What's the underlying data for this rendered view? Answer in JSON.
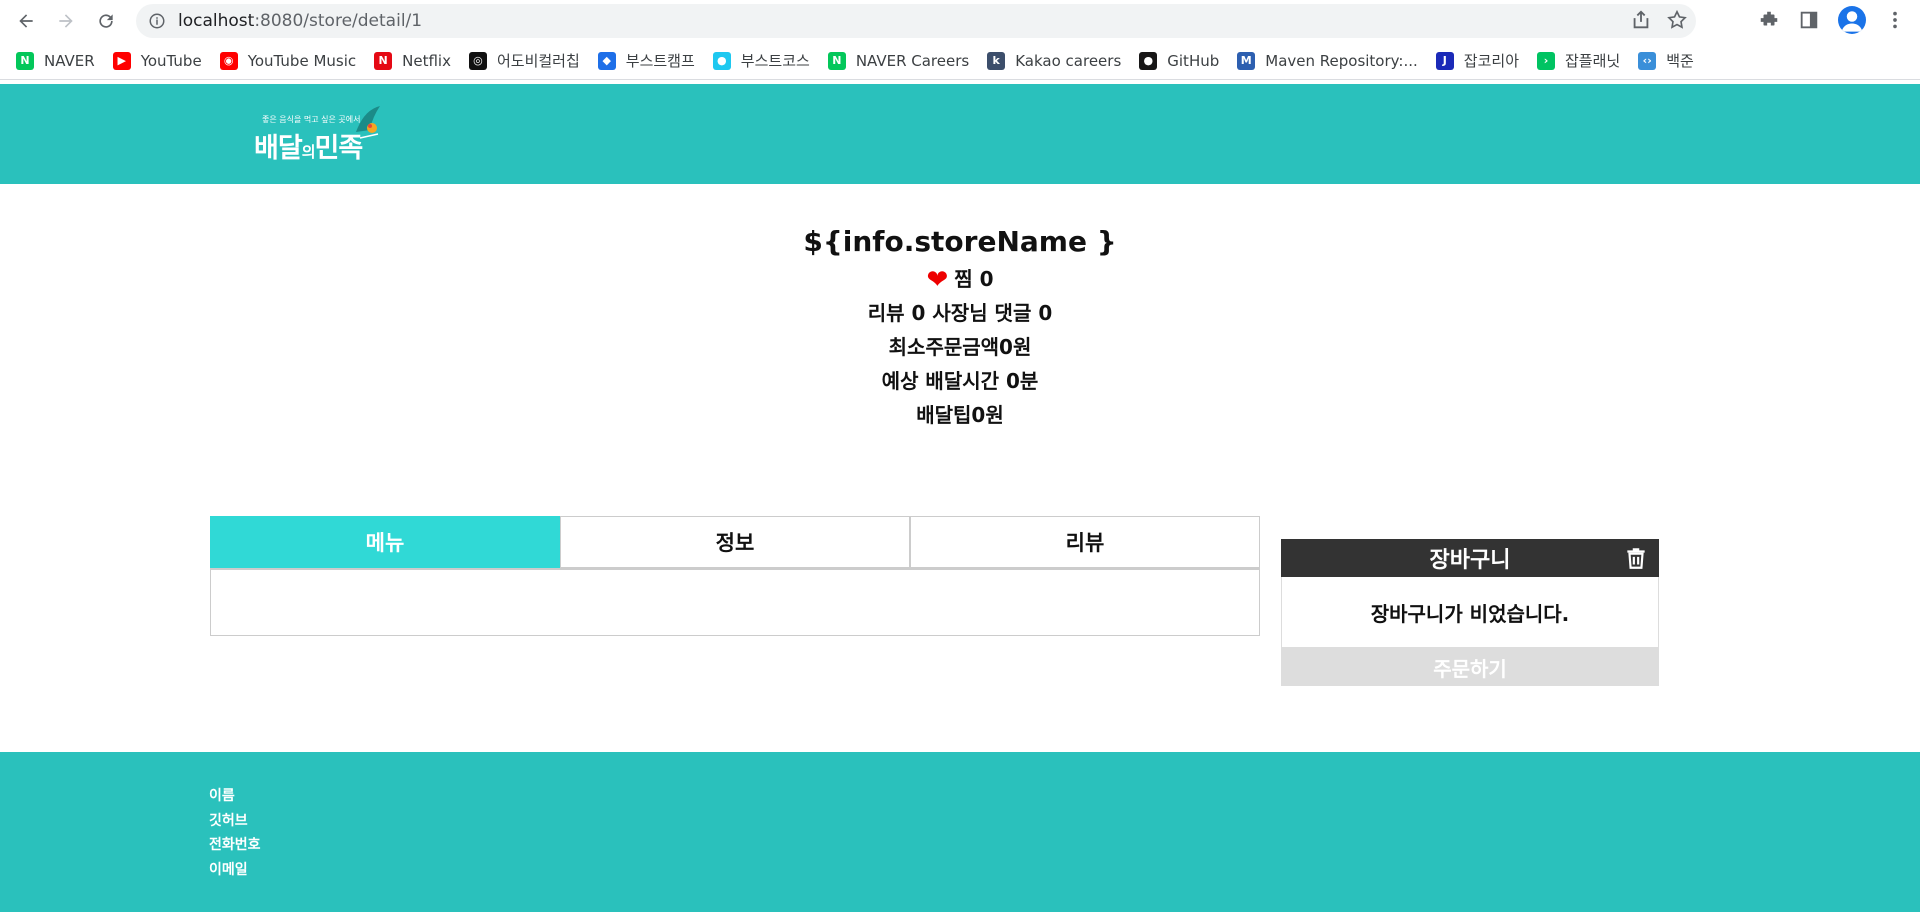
{
  "browser": {
    "url_host": "localhost",
    "url_path": ":8080/store/detail/1",
    "bookmarks": [
      {
        "label": "NAVER",
        "icon": "naver-icon",
        "color": "#03c75a",
        "glyph": "N"
      },
      {
        "label": "YouTube",
        "icon": "youtube-icon",
        "color": "#ff0000",
        "glyph": "▶"
      },
      {
        "label": "YouTube Music",
        "icon": "youtube-music-icon",
        "color": "#ff0000",
        "glyph": "◉"
      },
      {
        "label": "Netflix",
        "icon": "netflix-icon",
        "color": "#e50914",
        "glyph": "N"
      },
      {
        "label": "어도비컬러칩",
        "icon": "adobe-color-icon",
        "color": "#111111",
        "glyph": "◎"
      },
      {
        "label": "부스트캠프",
        "icon": "boostcamp-icon",
        "color": "#1e6fe8",
        "glyph": "◆"
      },
      {
        "label": "부스트코스",
        "icon": "boostcourse-icon",
        "color": "#1ec8f0",
        "glyph": "●"
      },
      {
        "label": "NAVER Careers",
        "icon": "naver-careers-icon",
        "color": "#03c75a",
        "glyph": "N"
      },
      {
        "label": "Kakao careers",
        "icon": "kakao-careers-icon",
        "color": "#3c4e6b",
        "glyph": "k"
      },
      {
        "label": "GitHub",
        "icon": "github-icon",
        "color": "#181717",
        "glyph": "●"
      },
      {
        "label": "Maven Repository:...",
        "icon": "maven-icon",
        "color": "#2d5fb0",
        "glyph": "M"
      },
      {
        "label": "잡코리아",
        "icon": "jobkorea-icon",
        "color": "#1b2ab8",
        "glyph": "J"
      },
      {
        "label": "잡플래닛",
        "icon": "jobplanet-icon",
        "color": "#00c362",
        "glyph": "›"
      },
      {
        "label": "백준",
        "icon": "baekjoon-icon",
        "color": "#3a8fd9",
        "glyph": "‹›"
      }
    ]
  },
  "header": {
    "logo_tagline": "좋은 음식을 먹고 싶은 곳에서",
    "logo_word_1": "배달",
    "logo_word_mid": "의",
    "logo_word_2": "민족",
    "bg_color": "#2ac1bc"
  },
  "store": {
    "name": "${info.storeName }",
    "like_line": "찜 0",
    "review_line": "리뷰 0 사장님 댓글 0",
    "min_order_line": "최소주문금액0원",
    "delivery_time_line": "예상 배달시간 0분",
    "delivery_tip_line": "배달팁0원"
  },
  "tabs": [
    {
      "label": "메뉴",
      "active": true
    },
    {
      "label": "정보",
      "active": false
    },
    {
      "label": "리뷰",
      "active": false
    }
  ],
  "cart": {
    "title": "장바구니",
    "empty_message": "장바구니가 비었습니다.",
    "order_label": "주문하기"
  },
  "footer": {
    "items": [
      "이름",
      "깃허브",
      "전화번호",
      "이메일"
    ]
  }
}
